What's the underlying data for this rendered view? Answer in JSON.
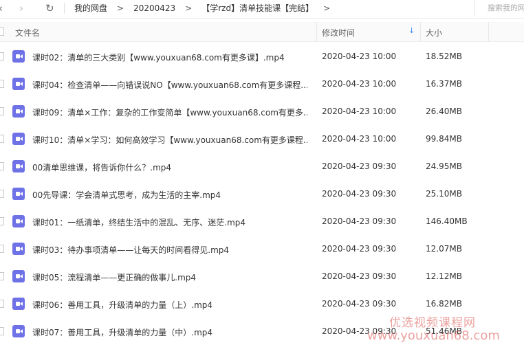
{
  "toolbar": {
    "back_icon": "chevron-left-icon",
    "forward_icon": "chevron-right-icon",
    "refresh_icon": "refresh-icon"
  },
  "breadcrumb": [
    "我的网盘",
    "20200423",
    "【学rzd】清单技能课【完结】"
  ],
  "breadcrumb_separator": ">",
  "search": {
    "placeholder": "搜索我的网"
  },
  "columns": {
    "name": "文件名",
    "time": "修改时间",
    "size": "大小",
    "sort_indicator": "↓"
  },
  "files": [
    {
      "name": "课时02：清单的三大类别【www.youxuan68.com有更多课】.mp4",
      "time": "2020-04-23 10:00",
      "size": "18.52MB"
    },
    {
      "name": "课时04：检查清单——向错误说NO【www.youxuan68.com有更多课程...",
      "time": "2020-04-23 10:00",
      "size": "16.37MB"
    },
    {
      "name": "课时09：清单×工作：复杂的工作变简单【www.youxuan68.com有更多...",
      "time": "2020-04-23 10:00",
      "size": "26.40MB"
    },
    {
      "name": "课时10：清单×学习：如何高效学习【www.youxuan68.com有更多课程...",
      "time": "2020-04-23 10:00",
      "size": "99.84MB"
    },
    {
      "name": "00清单思维课，将告诉你什么？.mp4",
      "time": "2020-04-23 09:30",
      "size": "24.95MB"
    },
    {
      "name": "00先导课：学会清单式思考，成为生活的主宰.mp4",
      "time": "2020-04-23 09:30",
      "size": "25.10MB"
    },
    {
      "name": "课时01：一纸清单，终结生活中的混乱、无序、迷茫.mp4",
      "time": "2020-04-23 09:30",
      "size": "146.40MB"
    },
    {
      "name": "课时03：待办事项清单——让每天的时间看得见.mp4",
      "time": "2020-04-23 09:30",
      "size": "12.07MB"
    },
    {
      "name": "课时05：流程清单——更正确的做事儿.mp4",
      "time": "2020-04-23 09:30",
      "size": "12.12MB"
    },
    {
      "name": "课时06：善用工具，升级清单的力量（上）.mp4",
      "time": "2020-04-23 09:30",
      "size": "16.82MB"
    },
    {
      "name": "课时07：善用工具，升级清单的力量（中）.mp4",
      "time": "2020-04-23 09:30",
      "size": "51.46MB"
    }
  ],
  "file_icon": "video-file-icon",
  "watermark": {
    "line1": "优选视频课程网",
    "line2": "www.youxuan68.com"
  }
}
